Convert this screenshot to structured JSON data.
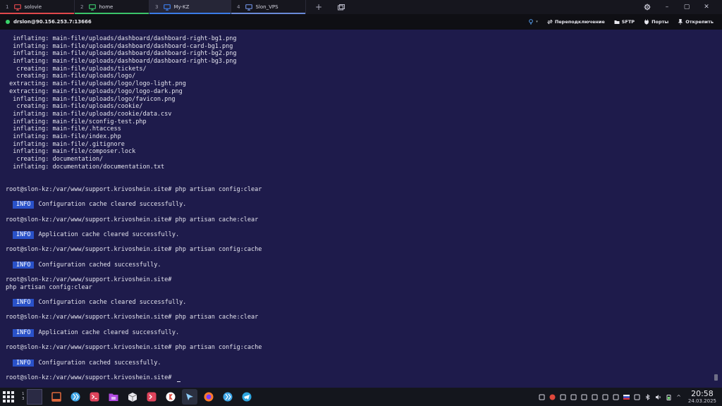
{
  "tabs": [
    {
      "num": "1",
      "label": "solovie",
      "active": false,
      "icon": "monitor-icon",
      "color": "#e0484c"
    },
    {
      "num": "2",
      "label": "home",
      "active": false,
      "icon": "monitor-icon",
      "color": "#3bc46a"
    },
    {
      "num": "3",
      "label": "My-KZ",
      "active": true,
      "icon": "monitor-icon",
      "color": "#3b7be8"
    },
    {
      "num": "4",
      "label": "Slon_VPS",
      "active": false,
      "icon": "monitor-icon",
      "color": "#6a8ad8"
    }
  ],
  "tab_actions": {
    "add": "+",
    "layout_icon": "window-layout-icon"
  },
  "window_controls": {
    "settings_icon": "gear-icon",
    "minimize": "–",
    "maximize": "▢",
    "close": "✕"
  },
  "session": {
    "host": "drslon@90.156.253.7:13666",
    "status_color": "#39d46a",
    "actions": [
      {
        "icon": "bulb-icon",
        "label": "",
        "has_caret": true
      },
      {
        "icon": "switch-icon",
        "label": "Переподключение"
      },
      {
        "icon": "folder-icon",
        "label": "SFTP"
      },
      {
        "icon": "plug-icon",
        "label": "Порты"
      },
      {
        "icon": "pin-icon",
        "label": "Открепить"
      }
    ]
  },
  "terminal": {
    "lines": [
      {
        "text": "  inflating: main-file/uploads/dashboard/dashboard-right-bg1.png"
      },
      {
        "text": "  inflating: main-file/uploads/dashboard/dashboard-card-bg1.png"
      },
      {
        "text": "  inflating: main-file/uploads/dashboard/dashboard-right-bg2.png"
      },
      {
        "text": "  inflating: main-file/uploads/dashboard/dashboard-right-bg3.png"
      },
      {
        "text": "   creating: main-file/uploads/tickets/"
      },
      {
        "text": "   creating: main-file/uploads/logo/"
      },
      {
        "text": " extracting: main-file/uploads/logo/logo-light.png"
      },
      {
        "text": " extracting: main-file/uploads/logo/logo-dark.png"
      },
      {
        "text": "  inflating: main-file/uploads/logo/favicon.png"
      },
      {
        "text": "   creating: main-file/uploads/cookie/"
      },
      {
        "text": "  inflating: main-file/uploads/cookie/data.csv"
      },
      {
        "text": "  inflating: main-file/sconfig-test.php"
      },
      {
        "text": "  inflating: main-file/.htaccess"
      },
      {
        "text": "  inflating: main-file/index.php"
      },
      {
        "text": "  inflating: main-file/.gitignore"
      },
      {
        "text": "  inflating: main-file/composer.lock"
      },
      {
        "text": "   creating: documentation/"
      },
      {
        "text": "  inflating: documentation/documentation.txt"
      },
      {
        "text": ""
      },
      {
        "text": ""
      },
      {
        "text": "root@slon-kz:/var/www/support.krivoshein.site# php artisan config:clear"
      },
      {
        "text": ""
      },
      {
        "badge": "INFO",
        "text": "Configuration cache cleared successfully."
      },
      {
        "text": ""
      },
      {
        "text": "root@slon-kz:/var/www/support.krivoshein.site# php artisan cache:clear"
      },
      {
        "text": ""
      },
      {
        "badge": "INFO",
        "text": "Application cache cleared successfully."
      },
      {
        "text": ""
      },
      {
        "text": "root@slon-kz:/var/www/support.krivoshein.site# php artisan config:cache"
      },
      {
        "text": ""
      },
      {
        "badge": "INFO",
        "text": "Configuration cached successfully."
      },
      {
        "text": ""
      },
      {
        "text": "root@slon-kz:/var/www/support.krivoshein.site#"
      },
      {
        "text": "php artisan config:clear"
      },
      {
        "text": ""
      },
      {
        "badge": "INFO",
        "text": "Configuration cache cleared successfully."
      },
      {
        "text": ""
      },
      {
        "text": "root@slon-kz:/var/www/support.krivoshein.site# php artisan cache:clear"
      },
      {
        "text": ""
      },
      {
        "badge": "INFO",
        "text": "Application cache cleared successfully."
      },
      {
        "text": ""
      },
      {
        "text": "root@slon-kz:/var/www/support.krivoshein.site# php artisan config:cache"
      },
      {
        "text": ""
      },
      {
        "badge": "INFO",
        "text": "Configuration cached successfully."
      },
      {
        "text": ""
      },
      {
        "text": "root@slon-kz:/var/www/support.krivoshein.site# ",
        "cursor": true
      }
    ],
    "badge_color": "#2a52c9"
  },
  "taskbar": {
    "pager": {
      "rows": [
        "1",
        "3"
      ]
    },
    "apps": [
      {
        "icon": "panel-icon",
        "color": "#e0683c"
      },
      {
        "icon": "kde-connect-icon",
        "color": "#3ea6e8"
      },
      {
        "icon": "terminal-app-icon",
        "color": "#e0445c"
      },
      {
        "icon": "folder-app-icon",
        "color": "#b04adf"
      },
      {
        "icon": "package-icon",
        "color": "#e8e8ee"
      },
      {
        "icon": "termius-icon",
        "color": "#e0445c"
      },
      {
        "icon": "yandex-browser-icon",
        "color": "#e0483c"
      },
      {
        "icon": "cursor-ide-icon",
        "color": "#8fd0ff",
        "active": true
      },
      {
        "icon": "firefox-icon",
        "color": "#ff7a2a"
      },
      {
        "icon": "kde-connect-icon",
        "color": "#3ea6e8"
      },
      {
        "icon": "telegram-icon",
        "color": "#2ea6e0"
      }
    ],
    "tray": [
      "notes-icon",
      "yandex-icon",
      "lock-icon",
      "disk-icon",
      "weather-icon",
      "clipboard-icon",
      "play-icon",
      "headset-icon",
      "flag-ru-icon",
      "display-icon",
      "bluetooth-icon",
      "volume-icon",
      "battery-icon"
    ],
    "time": "20:58",
    "date": "24.03.2025"
  }
}
